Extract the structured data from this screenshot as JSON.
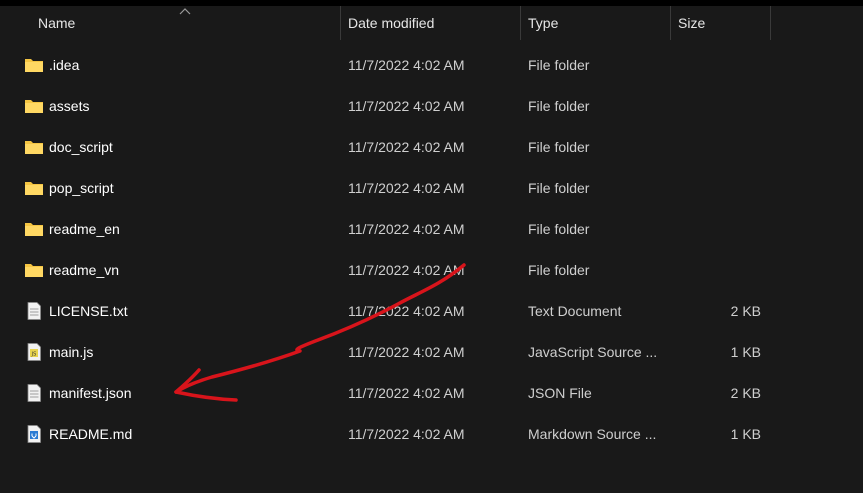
{
  "columns": {
    "name": "Name",
    "date_modified": "Date modified",
    "type": "Type",
    "size": "Size"
  },
  "files": [
    {
      "name": ".idea",
      "date": "11/7/2022 4:02 AM",
      "type": "File folder",
      "size": "",
      "icon": "folder-icon"
    },
    {
      "name": "assets",
      "date": "11/7/2022 4:02 AM",
      "type": "File folder",
      "size": "",
      "icon": "folder-icon"
    },
    {
      "name": "doc_script",
      "date": "11/7/2022 4:02 AM",
      "type": "File folder",
      "size": "",
      "icon": "folder-icon"
    },
    {
      "name": "pop_script",
      "date": "11/7/2022 4:02 AM",
      "type": "File folder",
      "size": "",
      "icon": "folder-icon"
    },
    {
      "name": "readme_en",
      "date": "11/7/2022 4:02 AM",
      "type": "File folder",
      "size": "",
      "icon": "folder-icon"
    },
    {
      "name": "readme_vn",
      "date": "11/7/2022 4:02 AM",
      "type": "File folder",
      "size": "",
      "icon": "folder-icon"
    },
    {
      "name": "LICENSE.txt",
      "date": "11/7/2022 4:02 AM",
      "type": "Text Document",
      "size": "2 KB",
      "icon": "text-file-icon"
    },
    {
      "name": "main.js",
      "date": "11/7/2022 4:02 AM",
      "type": "JavaScript Source ...",
      "size": "1 KB",
      "icon": "js-file-icon"
    },
    {
      "name": "manifest.json",
      "date": "11/7/2022 4:02 AM",
      "type": "JSON File",
      "size": "2 KB",
      "icon": "text-file-icon"
    },
    {
      "name": "README.md",
      "date": "11/7/2022 4:02 AM",
      "type": "Markdown Source ...",
      "size": "1 KB",
      "icon": "markdown-file-icon"
    }
  ],
  "colors": {
    "background": "#191919",
    "folder": "#f5c542",
    "annotation": "#d8141b"
  }
}
